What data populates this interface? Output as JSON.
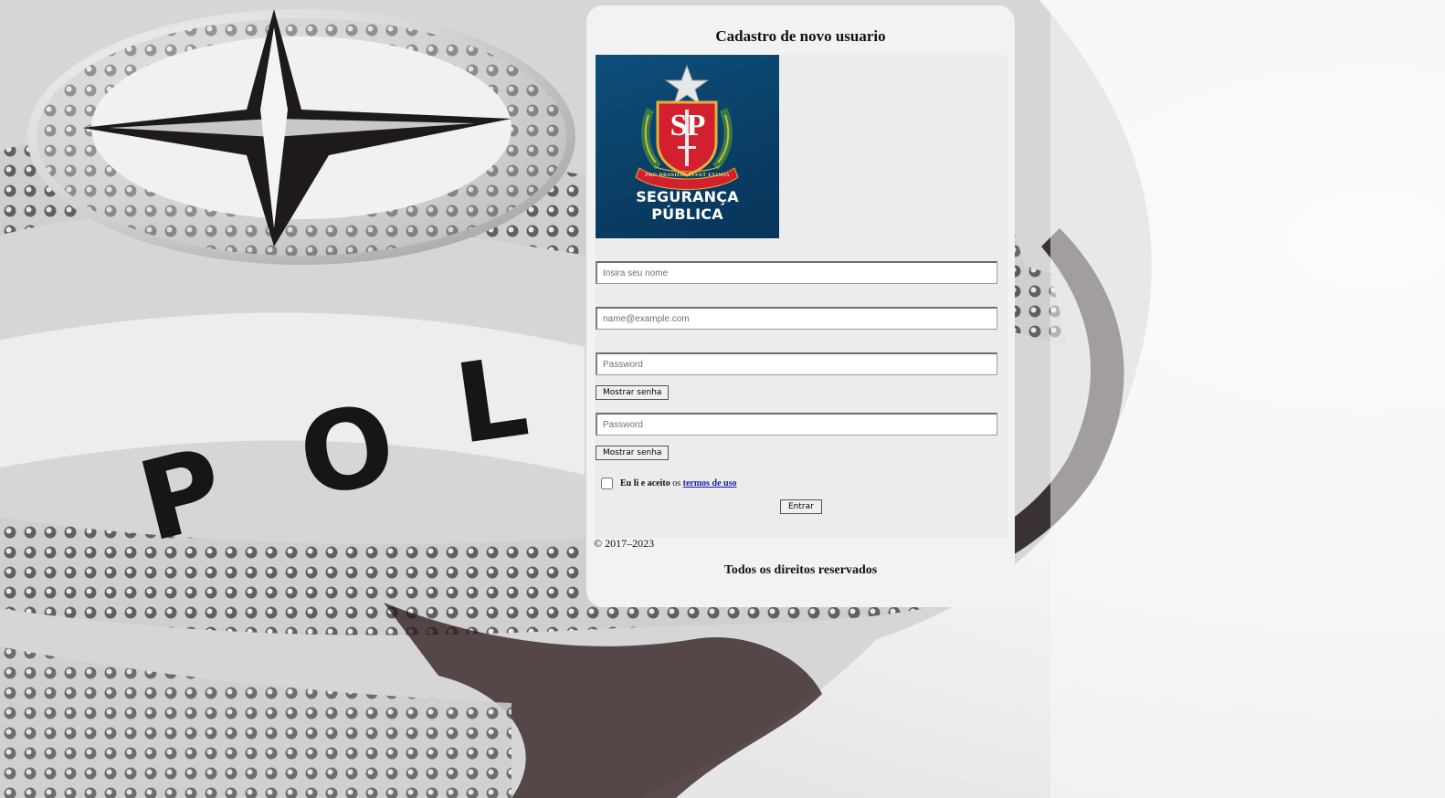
{
  "page": {
    "title": "Cadastro de novo usuario",
    "background_description": "police-badge-photo"
  },
  "logo": {
    "line1": "SEGURANÇA",
    "line2": "PÚBLICA",
    "emblem_letters": "SP",
    "emblem_motto": "PRO BRASILIA FIANT EXIMIA",
    "colors": {
      "background": "#0b4470",
      "shield": "#d3202f",
      "gold": "#e2b13c"
    }
  },
  "form": {
    "name_placeholder": "Insira seu nome",
    "email_placeholder": "name@example.com",
    "password_placeholder": "Password",
    "confirm_password_placeholder": "Password",
    "show_password_label": "Mostrar senha",
    "show_password_label_2": "Mostrar senha",
    "terms_prefix": "Eu li e aceito",
    "terms_middle": "os",
    "terms_link": "termos de uso",
    "submit_label": "Entrar"
  },
  "footer": {
    "copyright": "© 2017–2023",
    "rights": "Todos os direitos reservados"
  }
}
